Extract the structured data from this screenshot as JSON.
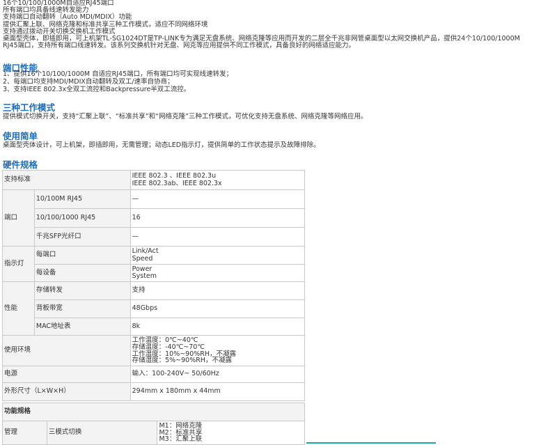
{
  "intro_lines": [
    "16个10/100/1000M自适应RJ45端口",
    "所有端口均具备线速转发能力",
    "支持端口自动翻转（Auto MDI/MDIX）功能",
    "提供汇聚上联、网络克隆和标准共享三种工作模式，适应不同网络环境",
    "支持通过拨动开关切换交换机工作模式",
    "桌面型壳体，即插即用，可上机架TL-SG1024DT是TP-LINK专为满足无盘系统、网络克隆等应用而开发的二层全千兆非网管桌面型以太网交换机产品，提供24个10/100/1000M",
    "RJ45端口，支持所有端口线速转发。该系列交换机针对无盘、网克等应用提供不同工作模式，具备良好的网络适应能力。"
  ],
  "sections": {
    "port": {
      "title": "端口性能",
      "lines": [
        "1、提供16个10/100/1000M 自适应RJ45端口，所有端口均可实现线速转发；",
        "2、每端口均支持MDI/MDIX自动翻转及双工/速率自协商；",
        "3、支持IEEE 802.3x全双工流控和Backpressure半双工流控。"
      ]
    },
    "modes": {
      "title": "三种工作模式",
      "lines": [
        "提供模式切换开关，支持“汇聚上联”、“标准共享”和“网络克隆”三种工作模式，可优化支持无盘系统、网络克隆等网络应用。"
      ]
    },
    "simple": {
      "title": "使用简单",
      "lines": [
        "桌面型壳体设计，可上机架，即插即用，无需管理；动态LED指示灯，提供简单的工作状态提示及故障排除。"
      ]
    },
    "hardware": {
      "title": "硬件规格"
    }
  },
  "hw": {
    "standard": {
      "label": "支持标准",
      "v1": "IEEE 802.3 、IEEE 802.3u",
      "v2": "IEEE 802.3ab、IEEE 802.3x"
    },
    "port": {
      "label": "端口",
      "r1": {
        "name": "10/100M RJ45",
        "value": "—"
      },
      "r2": {
        "name": "10/100/1000 RJ45",
        "value": "16"
      },
      "r3": {
        "name": "千兆SFP光纤口",
        "value": "—"
      }
    },
    "led": {
      "label": "指示灯",
      "r1": {
        "name": "每端口",
        "v1": "Link/Act",
        "v2": "Speed"
      },
      "r2": {
        "name": "每设备",
        "v1": "Power",
        "v2": "System"
      }
    },
    "perf": {
      "label": "性能",
      "r1": {
        "name": "存储转发",
        "value": "支持"
      },
      "r2": {
        "name": "背板带宽",
        "value": "48Gbps"
      },
      "r3": {
        "name": "MAC地址表",
        "value": "8k"
      }
    },
    "env": {
      "label": "使用环境",
      "v1": "工作温度：0℃~40℃",
      "v2": "存储温度：-40℃~70℃",
      "v3": "工作湿度：10%~90%RH，不凝露",
      "v4": "存储湿度：5%~90%RH，不凝露"
    },
    "power": {
      "label": "电源",
      "value": "输入：100-240V~ 50/60Hz"
    },
    "size": {
      "label": "外形尺寸（L×W×H）",
      "value": "294mm x 180mm x 44mm"
    }
  },
  "func": {
    "title": "功能规格",
    "manage": {
      "label": "管理",
      "name": "三模式切换",
      "v1": "M1：网络克隆",
      "v2": "M2：标准共享",
      "v3": "M3：汇聚上联"
    }
  },
  "colors": {
    "heading": "#1a6dbd",
    "accent_line": "#22a3a3"
  }
}
